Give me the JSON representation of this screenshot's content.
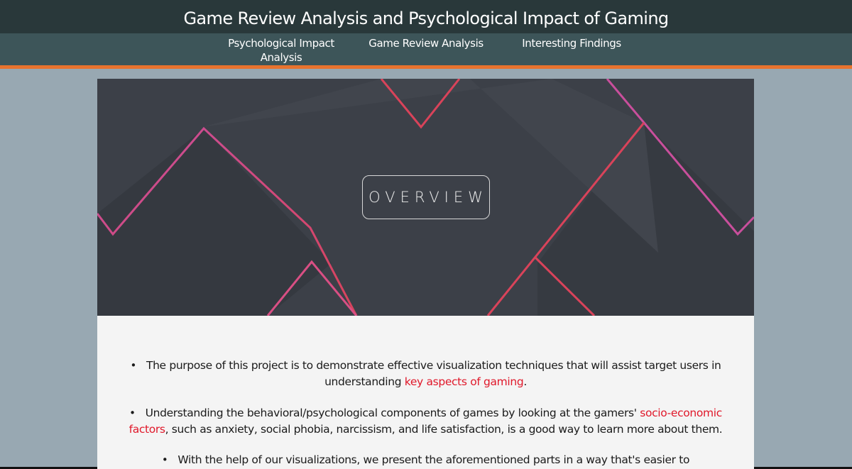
{
  "header": {
    "title": "Game Review Analysis and Psychological Impact of Gaming"
  },
  "nav": {
    "items": [
      {
        "label": "Psychological Impact Analysis"
      },
      {
        "label": "Game Review Analysis"
      },
      {
        "label": "Interesting Findings"
      }
    ]
  },
  "hero": {
    "label": "OVERVIEW"
  },
  "content": {
    "bullets": [
      {
        "marker": "•",
        "before": "The purpose of this project is to demonstrate effective visualization techniques that will assist target users in understanding ",
        "highlight": "key aspects of gaming",
        "after": "."
      },
      {
        "marker": "•",
        "before": "Understanding the behavioral/psychological components of games by looking at the gamers' ",
        "highlight": "socio-economic factors",
        "after": ", such as anxiety, social phobia, narcissism, and life satisfaction, is a good way to learn more about them."
      },
      {
        "marker": "•",
        "before": "With the help of our visualizations, we present the aforementioned parts in a way that's easier to comprehend.",
        "highlight": "",
        "after": ""
      }
    ]
  },
  "colors": {
    "header_bg": "#29383a",
    "nav_bg": "#3d5559",
    "nav_accent": "#e8732e",
    "page_bg": "#98a8b2",
    "hero_bg": "#3c4048",
    "hero_line_pink": "#c94f9c",
    "hero_line_red": "#d9435a",
    "highlight": "#e0182a"
  }
}
